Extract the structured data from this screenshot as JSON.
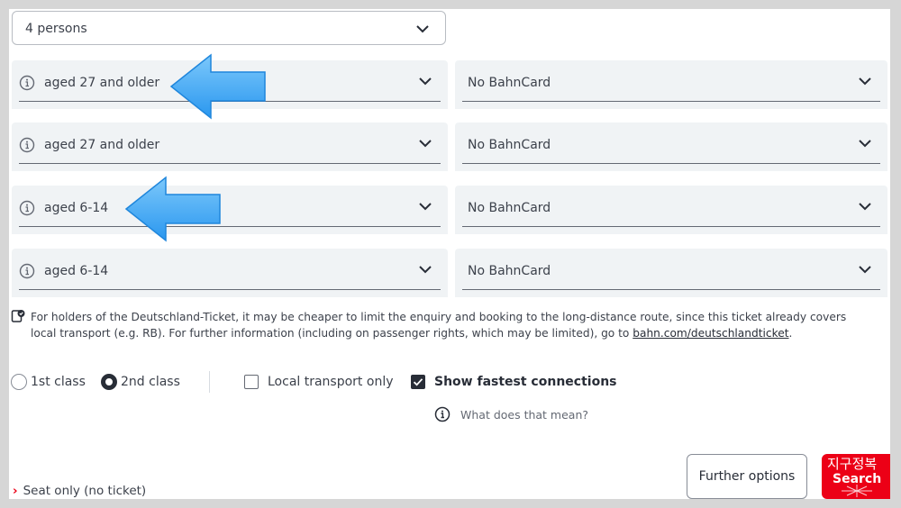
{
  "persons": {
    "value": "4 persons"
  },
  "travellers": [
    {
      "age": "aged 27 and older",
      "card": "No BahnCard"
    },
    {
      "age": "aged 27 and older",
      "card": "No BahnCard"
    },
    {
      "age": "aged 6-14",
      "card": "No BahnCard"
    },
    {
      "age": "aged 6-14",
      "card": "No BahnCard"
    }
  ],
  "note": {
    "text": "For holders of the Deutschland-Ticket, it may be cheaper to limit the enquiry and booking to the long-distance route, since this ticket already covers local transport (e.g. RB). For further information (including on passenger rights, which may be limited), go to ",
    "link": "bahn.com/deutschlandticket",
    "end": "."
  },
  "classes": {
    "first": "1st class",
    "second": "2nd class",
    "selected": "2nd class"
  },
  "checkboxes": {
    "local": {
      "label": "Local transport only",
      "checked": false
    },
    "fastest": {
      "label": "Show fastest connections",
      "checked": true
    }
  },
  "help": {
    "label": "What does that mean?"
  },
  "seat_only": {
    "label": "Seat only (no ticket)"
  },
  "buttons": {
    "further": "Further options",
    "search": "Search"
  },
  "watermark": "지구정복",
  "colors": {
    "brand_red": "#ec0016",
    "annotation_arrow": "#3fa9f5",
    "field_bg": "#f0f3f5"
  }
}
